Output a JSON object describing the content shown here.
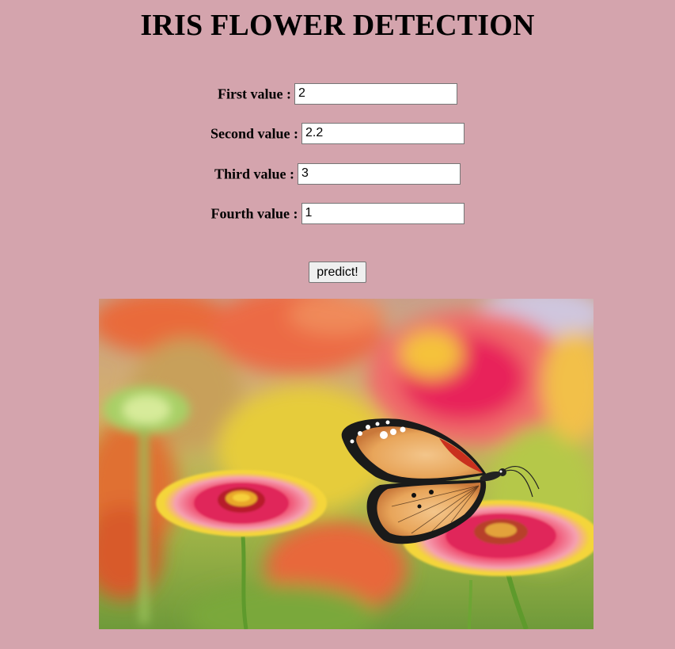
{
  "page": {
    "title": "IRIS FLOWER DETECTION"
  },
  "form": {
    "fields": [
      {
        "label": "First value :",
        "value": "2"
      },
      {
        "label": "Second value :",
        "value": "2.2"
      },
      {
        "label": "Third value :",
        "value": "3"
      },
      {
        "label": "Fourth value :",
        "value": "1"
      }
    ],
    "submit_label": "predict!"
  },
  "image": {
    "subject": "butterfly-on-gaillardia-flowers"
  },
  "colors": {
    "background": "#d4a4ad",
    "button": "#efefef"
  }
}
